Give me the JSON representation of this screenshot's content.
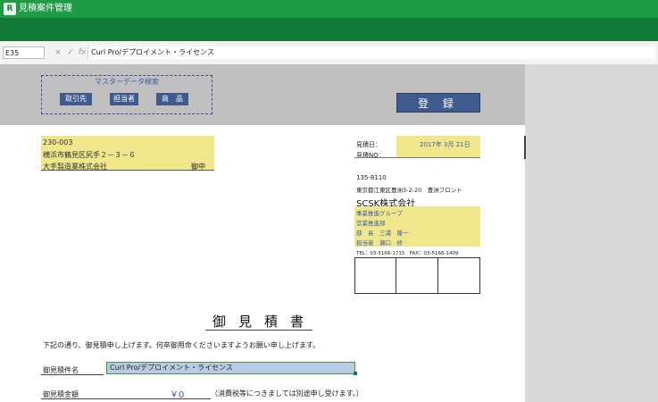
{
  "window": {
    "title": "見積案件管理",
    "app_icon": "app-logo-icon"
  },
  "formula_bar": {
    "cell_ref": "E35",
    "cancel_icon": "×",
    "confirm_icon": "✓",
    "fx_icon": "fx",
    "content": "Curl Pro/デプロイメント・ライセンス"
  },
  "master": {
    "title": "マスターデータ検索",
    "buttons": [
      "取引先",
      "担当者",
      "商　品"
    ]
  },
  "register_label": "登 録",
  "customer": {
    "postal": "230-003",
    "address": "横浜市鶴見区尻手２－３－６",
    "company": "大手製造業株式会社",
    "honorific": "御中"
  },
  "estimate": {
    "date_label": "見積日：",
    "date_value": "2017年 3月 21日",
    "no_label": "見積NO："
  },
  "issuer": {
    "postal": "135-8110",
    "address": "東京都江東区豊洲3-2-20　豊洲フロント",
    "company": "SCSK株式会社",
    "dept1": "事業推進グループ",
    "dept2": "営業推進部",
    "manager": "部　長　三浦　隆一",
    "staff": "担当者　瀬口　修",
    "tel": "TEL：03-5166-1715　FAX：03-5166-1409"
  },
  "document": {
    "title": "御見積書",
    "intro": "下記の通り、御見積申し上げます。何卒御用命くださいますようお願い申し上げます。",
    "subject_label": "御見積件名",
    "subject_value": "Curl Pro/デプロイメント・ライセンス",
    "amount_label": "御見積金額",
    "amount_value": "￥0",
    "tax_note": "（消費税等につきましては別途申し受けます。）"
  },
  "colors": {
    "titlebar": "#1f9a45",
    "ribbon": "#107a36",
    "button": "#3f5a8c",
    "highlight": "#f0e68c"
  }
}
